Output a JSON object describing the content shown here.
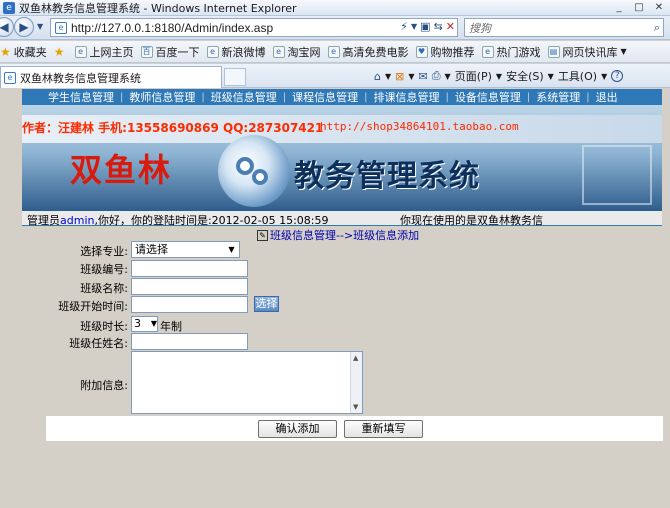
{
  "window": {
    "title": "双鱼林教务信息管理系统 - Windows Internet Explorer"
  },
  "address": {
    "url": "http://127.0.0.1:8180/Admin/index.asp"
  },
  "search": {
    "placeholder": "搜狗"
  },
  "favorites": {
    "label": "收藏夹",
    "items": [
      "上网主页",
      "百度一下",
      "新浪微博",
      "淘宝网",
      "高清免费电影",
      "购物推荐",
      "热门游戏",
      "网页快讯库"
    ]
  },
  "tab": {
    "title": "双鱼林教务信息管理系统"
  },
  "commandbar": {
    "page": "页面(P)",
    "safety": "安全(S)",
    "tools": "工具(O)"
  },
  "nav": {
    "items": [
      "学生信息管理",
      "教师信息管理",
      "班级信息管理",
      "课程信息管理",
      "排课信息管理",
      "设备信息管理",
      "系统管理",
      "退出"
    ]
  },
  "banner": {
    "author": "作者：汪建林  手机:13558690869  QQ:287307421",
    "shop": "http://shop34864101.taobao.com",
    "brand": "双鱼林",
    "system": "教务管理系统"
  },
  "status": {
    "prefix": "管理员",
    "user": "admin",
    "suffix": ",你好，你的登陆时间是:2012-02-05 15:08:59",
    "right": "你现在使用的是双鱼林教务信"
  },
  "breadcrumb": "班级信息管理-->班级信息添加",
  "form": {
    "major_label": "选择专业:",
    "major_value": "请选择",
    "class_no_label": "班级编号:",
    "class_name_label": "班级名称:",
    "start_label": "班级开始时间:",
    "pick_label": "选择",
    "duration_label": "班级时长:",
    "duration_value": "3",
    "duration_unit": "年制",
    "teacher_label": "班级任姓名:",
    "extra_label": "附加信息:",
    "submit": "确认添加",
    "reset": "重新填写"
  },
  "colors": {
    "nav_bg": "#2e78b7",
    "brand_red": "#d81b0c",
    "link_blue": "#0000aa"
  }
}
